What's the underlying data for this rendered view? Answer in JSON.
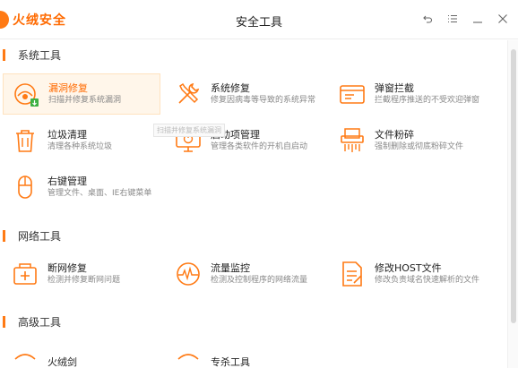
{
  "app": {
    "logo_text": "火绒安全",
    "title": "安全工具"
  },
  "window_controls": [
    "back-icon",
    "menu-icon",
    "minimize-icon",
    "close-icon"
  ],
  "colors": {
    "accent": "#ff7a14",
    "brand": "#ff6a00",
    "active_bg": "#fff6ea"
  },
  "sections": {
    "system": {
      "title": "系统工具",
      "tools": [
        {
          "name": "漏洞修复",
          "desc": "扫描并修复系统漏洞",
          "icon": "vulnerability-fix-icon",
          "active": true
        },
        {
          "name": "系统修复",
          "desc": "修复因病毒等导致的系统异常",
          "icon": "wrench-screwdriver-icon"
        },
        {
          "name": "弹窗拦截",
          "desc": "拦截程序推送的不受欢迎弹窗",
          "icon": "popup-block-icon"
        },
        {
          "name": "垃圾清理",
          "desc": "清理各种系统垃圾",
          "icon": "trash-icon"
        },
        {
          "name": "启动项管理",
          "desc": "管理各类软件的开机自启动",
          "icon": "startup-monitor-icon"
        },
        {
          "name": "文件粉碎",
          "desc": "强制删除或彻底粉碎文件",
          "icon": "shredder-icon"
        },
        {
          "name": "右键管理",
          "desc": "管理文件、桌面、IE右键菜单",
          "icon": "mouse-icon"
        }
      ]
    },
    "network": {
      "title": "网络工具",
      "tools": [
        {
          "name": "断网修复",
          "desc": "检测并修复断网问题",
          "icon": "network-repair-icon"
        },
        {
          "name": "流量监控",
          "desc": "检测及控制程序的网络流量",
          "icon": "traffic-gauge-icon"
        },
        {
          "name": "修改HOST文件",
          "desc": "修改负责域名快速解析的文件",
          "icon": "host-file-icon"
        }
      ]
    },
    "advanced": {
      "title": "高级工具",
      "tools": [
        {
          "name": "火绒剑",
          "desc": "",
          "icon": "sword-icon"
        },
        {
          "name": "专杀工具",
          "desc": "",
          "icon": "kill-tool-icon"
        }
      ]
    }
  },
  "tooltip": "扫描并修复系统漏洞"
}
